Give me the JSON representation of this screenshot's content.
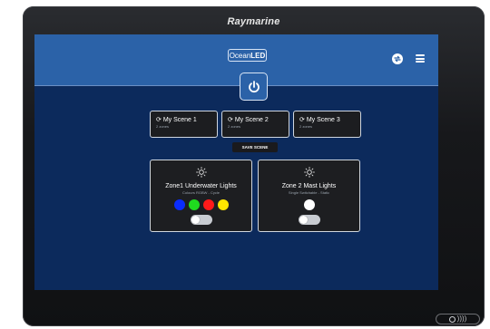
{
  "device": {
    "brand": "Raymarine"
  },
  "header": {
    "logo_prefix": "Ocean",
    "logo_suffix": "LED",
    "sync_icon": "sync-icon",
    "menu_icon": "hamburger-menu-icon",
    "accent_color": "#2b62a8",
    "background_color": "#0c2a5c"
  },
  "power": {
    "icon": "power-icon"
  },
  "scenes": [
    {
      "name": "My Scene 1",
      "subtitle": "2 zones"
    },
    {
      "name": "My Scene 2",
      "subtitle": "2 zones"
    },
    {
      "name": "My Scene 3",
      "subtitle": "2 zones"
    }
  ],
  "save_scene_label": "SAVE SCENE",
  "zones": [
    {
      "title": "Zone1 Underwater Lights",
      "subtitle": "Colours RGBW - Cycle",
      "colors": [
        "#0a2cff",
        "#1fdc1f",
        "#ff1a1a",
        "#ffe600"
      ],
      "toggle_on": false
    },
    {
      "title": "Zone 2 Mast Lights",
      "subtitle": "Single Switchable - Static",
      "colors": [
        "#ffffff"
      ],
      "toggle_on": false
    }
  ],
  "nav_indicator": "))))"
}
